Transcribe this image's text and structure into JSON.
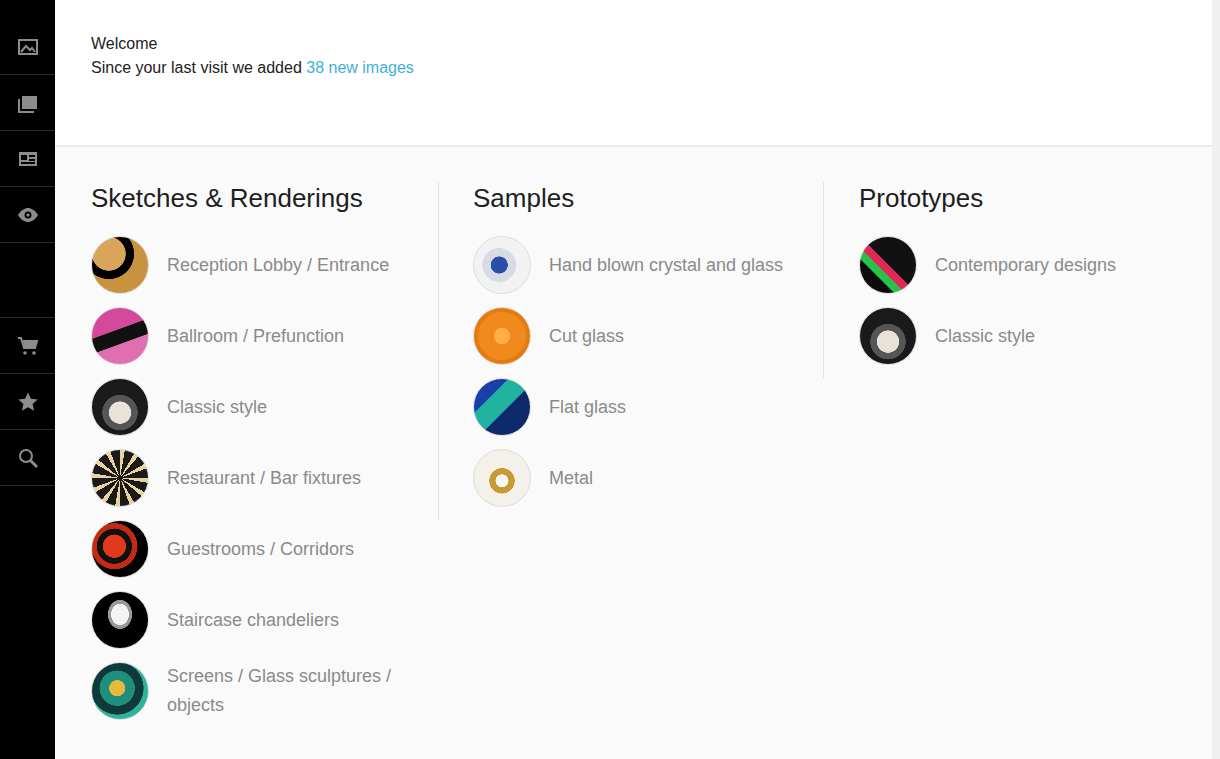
{
  "header": {
    "title": "Welcome",
    "message": "Since your last visit we added",
    "link": "38 new images"
  },
  "sections": [
    {
      "title": "Sketches & Renderings",
      "items": [
        {
          "label": "Reception Lobby / Entrance"
        },
        {
          "label": "Ballroom / Prefunction"
        },
        {
          "label": "Classic style"
        },
        {
          "label": "Restaurant / Bar fixtures"
        },
        {
          "label": "Guestrooms / Corridors"
        },
        {
          "label": "Staircase chandeliers"
        },
        {
          "label": "Screens / Glass sculptures / objects"
        }
      ]
    },
    {
      "title": "Samples",
      "items": [
        {
          "label": "Hand blown crystal and glass"
        },
        {
          "label": "Cut glass"
        },
        {
          "label": "Flat glass"
        },
        {
          "label": "Metal"
        }
      ]
    },
    {
      "title": "Prototypes",
      "items": [
        {
          "label": "Contemporary designs"
        },
        {
          "label": "Classic style"
        }
      ]
    }
  ]
}
